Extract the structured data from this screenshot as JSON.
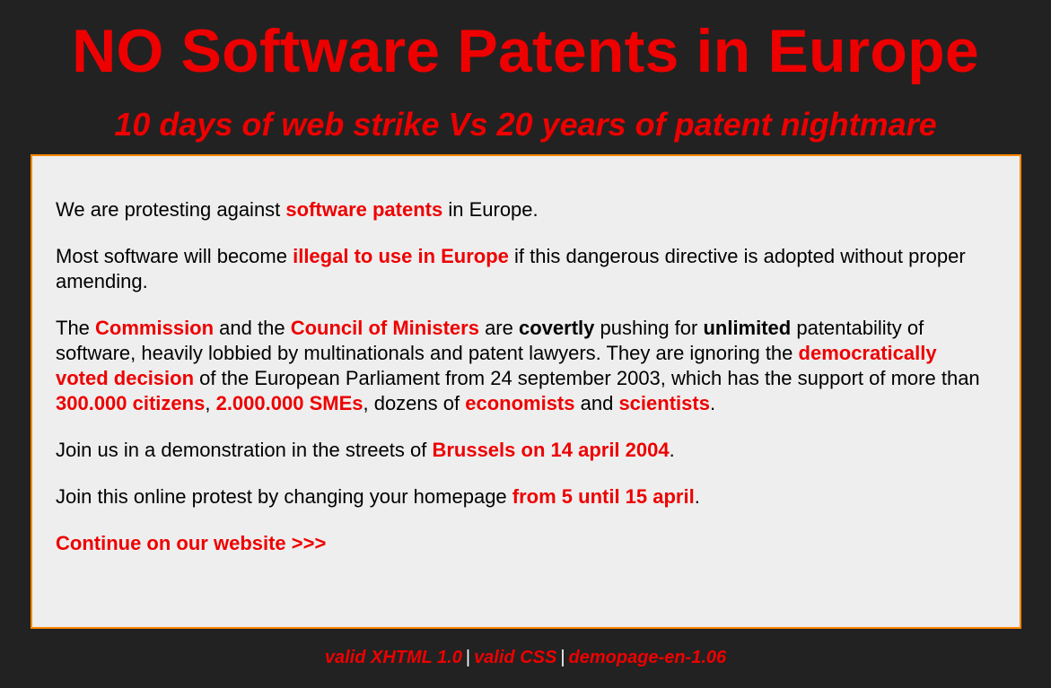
{
  "header": {
    "title": "NO Software Patents in Europe",
    "subtitle": "10 days of web strike Vs 20 years of patent nightmare"
  },
  "content": {
    "p1": {
      "before": "We are protesting against ",
      "link": "software patents",
      "after": " in Europe."
    },
    "p2": {
      "before": "Most software will become ",
      "link": "illegal to use in Europe",
      "after": " if this dangerous directive is adopted without proper amending."
    },
    "p3": {
      "t1": "The ",
      "commission": "Commission",
      "t2": " and the ",
      "council": "Council of Ministers",
      "t3": " are ",
      "covertly": "covertly",
      "t4": " pushing for ",
      "unlimited": "unlimited",
      "t5": " patentability of software, heavily lobbied by multinationals and patent lawyers. They are ignoring the ",
      "decision": "democratically voted decision",
      "t6": " of the European Parliament from 24 september 2003, which has the support of more than ",
      "citizens": "300.000 citizens",
      "t7": ", ",
      "smes": "2.000.000 SMEs",
      "t8": ", dozens of ",
      "economists": "economists",
      "t9": " and ",
      "scientists": "scientists",
      "t10": "."
    },
    "p4": {
      "before": "Join us in a demonstration in the streets of ",
      "link": "Brussels on 14 april 2004",
      "after": "."
    },
    "p5": {
      "before": "Join this online protest by changing your homepage ",
      "link": "from 5 until 15 april",
      "after": "."
    },
    "continue_link": "Continue on our website >>>"
  },
  "footer": {
    "xhtml": "valid XHTML 1.0",
    "css": "valid CSS",
    "version": "demopage-en-1.06",
    "separator": "|"
  },
  "colors": {
    "background": "#222222",
    "accent": "#ee0000",
    "box_bg": "#eeeeee",
    "box_border": "#ff8800"
  }
}
